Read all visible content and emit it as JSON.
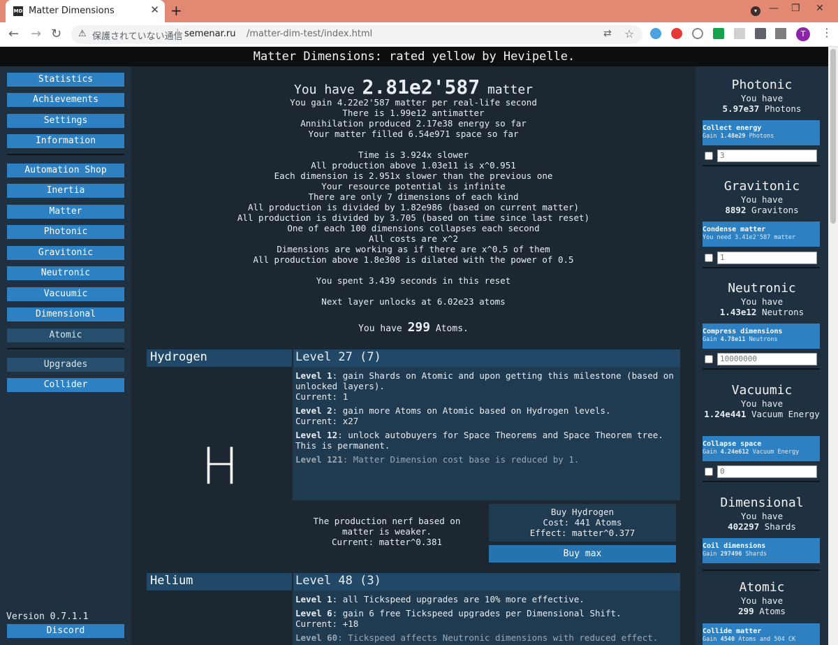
{
  "browser": {
    "tab_title": "Matter Dimensions",
    "tab_favicon_text": "MD",
    "security_text": "保護されていない通信",
    "url_host": "semenar.ru",
    "url_path": "/matter-dim-test/index.html",
    "avatar_letter": "T"
  },
  "header": {
    "title": "Matter Dimensions: rated yellow by Hevipelle."
  },
  "sidebar": {
    "nav_top": [
      {
        "label": "Statistics"
      },
      {
        "label": "Achievements"
      },
      {
        "label": "Settings"
      },
      {
        "label": "Information"
      }
    ],
    "nav_tabs": [
      {
        "label": "Automation Shop"
      },
      {
        "label": "Inertia"
      },
      {
        "label": "Matter"
      },
      {
        "label": "Photonic"
      },
      {
        "label": "Gravitonic"
      },
      {
        "label": "Neutronic"
      },
      {
        "label": "Vacuumic"
      },
      {
        "label": "Dimensional"
      },
      {
        "label": "Atomic"
      }
    ],
    "nav_bottom": [
      {
        "label": "Upgrades"
      },
      {
        "label": "Collider"
      }
    ],
    "version": "Version 0.7.1.1",
    "discord_label": "Discord"
  },
  "main": {
    "have_prefix": "You have",
    "matter_amount": "2.81e2'587",
    "have_suffix": "matter",
    "stats_block1": [
      "You gain 4.22e2'587 matter per real-life second",
      "There is 1.99e12 antimatter",
      "Annihilation produced 2.17e38 energy so far",
      "Your matter filled 6.54e971 space so far"
    ],
    "stats_block2": [
      "Time is 3.924x slower",
      "All production above 1.03e11 is x^0.951",
      "Each dimension is 2.951x slower than the previous one",
      "Your resource potential is infinite",
      "There are only 7 dimensions of each kind",
      "All production is divided by 1.82e986 (based on current matter)",
      "All production is divided by 3.705 (based on time since last reset)",
      "One of each 100 dimensions collapses each second",
      "All costs are x^2",
      "Dimensions are working as if there are x^0.5 of them",
      "All production above 1.8e308 is dilated with the power of 0.5"
    ],
    "spent_time": "You spent 3.439 seconds in this reset",
    "next_layer": "Next layer unlocks at 6.02e23 atoms",
    "atoms_prefix": "You have",
    "atoms_amount": "299",
    "atoms_suffix": "Atoms.",
    "hydrogen": {
      "name": "Hydrogen",
      "level": "Level 27 (7)",
      "symbol": "H",
      "milestones": [
        {
          "label": "Level 1",
          "text": ": gain Shards on Atomic and upon getting this milestone (based on unlocked layers).",
          "current": "Current: 1"
        },
        {
          "label": "Level 2",
          "text": ": gain more Atoms on Atomic based on Hydrogen levels.",
          "current": "Current: x27"
        },
        {
          "label": "Level 12",
          "text": ": unlock autobuyers for Space Theorems and Space Theorem tree. This is permanent.",
          "current": ""
        },
        {
          "label": "Level 121",
          "text": ": Matter Dimension cost base is reduced by 1.",
          "current": ""
        }
      ],
      "nerf_lines": [
        "The production nerf based on",
        "matter is weaker.",
        "Current: matter^0.381"
      ],
      "buy_lines": [
        "Buy Hydrogen",
        "Cost: 441 Atoms",
        "Effect: matter^0.377"
      ],
      "buy_max": "Buy max"
    },
    "helium": {
      "name": "Helium",
      "level": "Level 48 (3)",
      "milestones": [
        {
          "label": "Level 1",
          "text": ": all Tickspeed upgrades are 10% more effective.",
          "current": ""
        },
        {
          "label": "Level 6",
          "text": ": gain 6 free Tickspeed upgrades per Dimensional Shift.",
          "current": "Current: +18"
        },
        {
          "label": "Level 60",
          "text": ": Tickspeed affects Neutronic dimensions with reduced effect.",
          "current": ""
        }
      ]
    }
  },
  "right": {
    "have_label": "You have",
    "panels": [
      {
        "title": "Photonic",
        "amount": "5.97e37",
        "unit": "Photons",
        "button": "Collect energy",
        "sub_prefix": "Gain",
        "sub_amount": "1.48e29",
        "sub_suffix": "Photons",
        "input": "3"
      },
      {
        "title": "Gravitonic",
        "amount": "8892",
        "unit": "Gravitons",
        "button": "Condense matter",
        "sub_prefix": "You need",
        "sub_amount": "3.41e2'587",
        "sub_suffix": "matter",
        "input": "1"
      },
      {
        "title": "Neutronic",
        "amount": "1.43e12",
        "unit": "Neutrons",
        "button": "Compress dimensions",
        "sub_prefix": "Gain",
        "sub_amount": "4.78e11",
        "sub_suffix": "Neutrons",
        "input": "10000000"
      },
      {
        "title": "Vacuumic",
        "amount": "1.24e441",
        "unit": "Vacuum Energy",
        "button": "Collapse space",
        "sub_prefix": "Gain",
        "sub_amount": "4.24e612",
        "sub_suffix": "Vacuum Energy",
        "input": "0"
      },
      {
        "title": "Dimensional",
        "amount": "402297",
        "unit": "Shards",
        "button": "Coil dimensions",
        "sub_prefix": "Gain",
        "sub_amount": "297496",
        "sub_suffix": "Shards",
        "input": ""
      },
      {
        "title": "Atomic",
        "amount": "299",
        "unit": "Atoms",
        "button": "Collide matter",
        "sub_prefix": "Gain",
        "sub_amount": "4540",
        "sub_suffix": "Atoms and 504 CK",
        "input": ""
      }
    ]
  }
}
